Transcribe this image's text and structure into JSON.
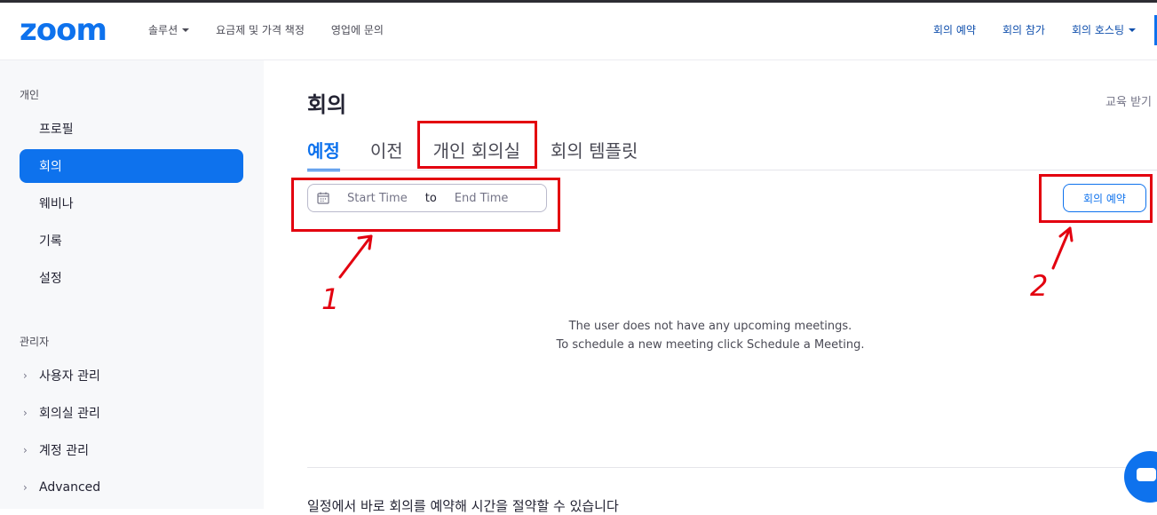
{
  "header": {
    "logo": "zoom",
    "nav_left": [
      {
        "label": "솔루션",
        "dropdown": true
      },
      {
        "label": "요금제 및 가격 책정",
        "dropdown": false
      },
      {
        "label": "영업에 문의",
        "dropdown": false
      }
    ],
    "nav_right": [
      {
        "label": "회의 예약",
        "dropdown": false
      },
      {
        "label": "회의 참가",
        "dropdown": false
      },
      {
        "label": "회의 호스팅",
        "dropdown": true
      }
    ]
  },
  "sidebar": {
    "personal_title": "개인",
    "personal_items": [
      {
        "label": "프로필",
        "active": false
      },
      {
        "label": "회의",
        "active": true
      },
      {
        "label": "웨비나",
        "active": false
      },
      {
        "label": "기록",
        "active": false
      },
      {
        "label": "설정",
        "active": false
      }
    ],
    "admin_title": "관리자",
    "admin_items": [
      {
        "label": "사용자 관리"
      },
      {
        "label": "회의실 관리"
      },
      {
        "label": "계정 관리"
      },
      {
        "label": "Advanced"
      }
    ]
  },
  "main": {
    "title": "회의",
    "edu_link": "교육 받기",
    "tabs": [
      {
        "label": "예정",
        "active": true
      },
      {
        "label": "이전",
        "active": false
      },
      {
        "label": "개인 회의실",
        "active": false
      },
      {
        "label": "회의 템플릿",
        "active": false
      }
    ],
    "date_range": {
      "start_placeholder": "Start Time",
      "separator": "to",
      "end_placeholder": "End Time"
    },
    "schedule_button": "회의 예약",
    "empty_line1": "The user does not have any upcoming meetings.",
    "empty_line2": "To schedule a new meeting click Schedule a Meeting.",
    "bottom_text": "일정에서 바로 회의를 예약해 시간을 절약할 수 있습니다"
  },
  "annotations": {
    "label1": "1",
    "label2": "2",
    "color": "#e3000f"
  },
  "colors": {
    "accent": "#0e72ed",
    "link": "#0e4eac",
    "sidebar_bg": "#f7f8fa"
  }
}
